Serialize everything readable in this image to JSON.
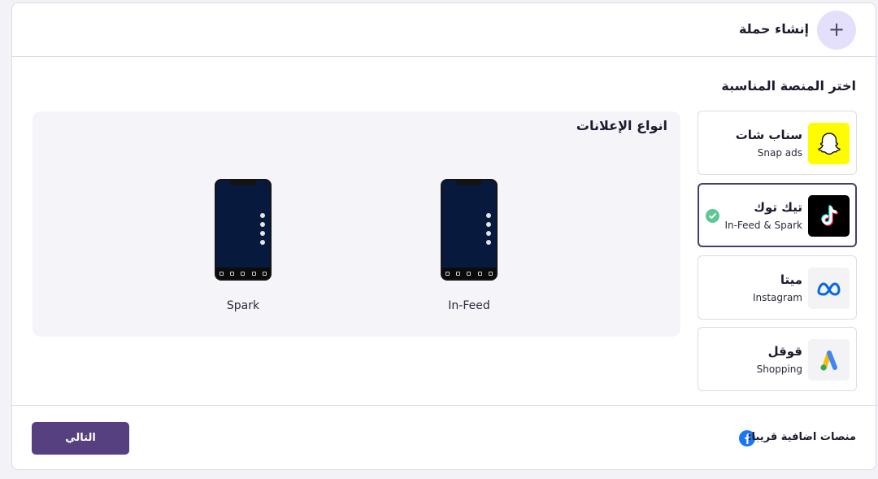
{
  "header": {
    "title": "إنشاء حملة",
    "plus_icon": "plus-icon"
  },
  "section": {
    "title": "اختر المنصة المناسبة"
  },
  "platforms": [
    {
      "name": "سناب شات",
      "subtitle": "Snap ads",
      "icon": "snapchat-icon",
      "color": "#FFFC00",
      "selected": false
    },
    {
      "name": "تيك توك",
      "subtitle": "In-Feed & Spark",
      "icon": "tiktok-icon",
      "color": "#000000",
      "selected": true
    },
    {
      "name": "ميتا",
      "subtitle": "Instagram",
      "icon": "meta-icon",
      "color": "#0668E1",
      "selected": false
    },
    {
      "name": "قوقل",
      "subtitle": "Shopping",
      "icon": "google-ads-icon",
      "color": "#4285F4",
      "selected": false
    }
  ],
  "ad_types": {
    "title": "انواع الإعلانات",
    "items": [
      {
        "label": "In-Feed"
      },
      {
        "label": "Spark"
      }
    ]
  },
  "footer": {
    "next_label": "التالي",
    "coming_soon": "منصات اضافية قريبا:",
    "coming_icon": "facebook-icon"
  },
  "colors": {
    "accent": "#56407F",
    "selected_border": "#4B3A74",
    "check": "#5FC796",
    "plus_bg": "#E4E0FB"
  }
}
